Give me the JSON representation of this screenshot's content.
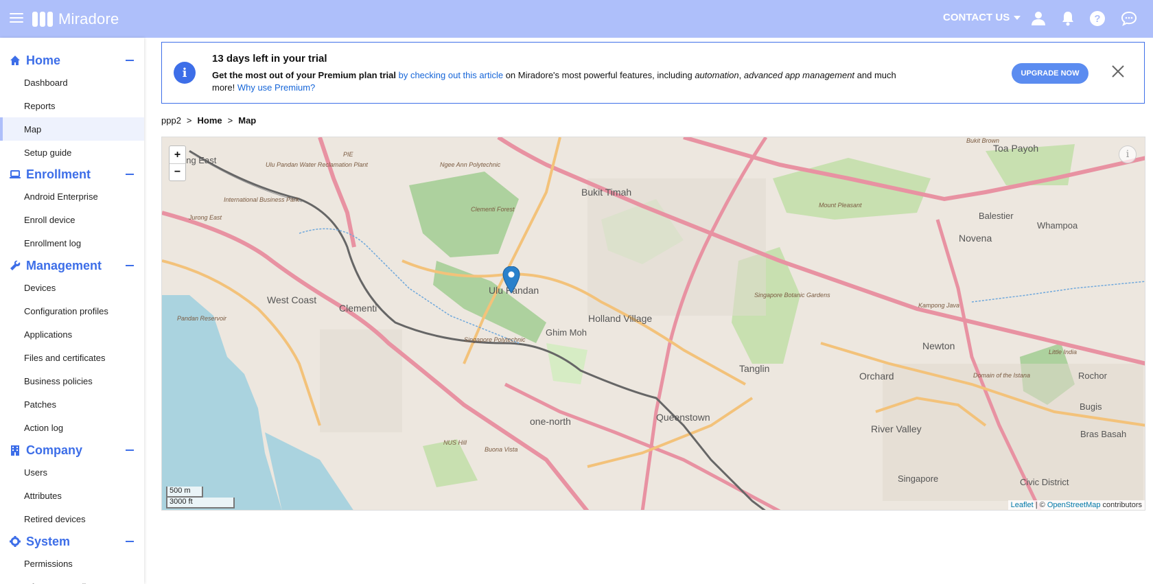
{
  "app": {
    "logo_text": "Miradore",
    "contact_label": "CONTACT US",
    "accent_color": "#3d6ee8",
    "topbar_color": "#aebffa"
  },
  "topbar_icons": [
    "user-icon",
    "bell-icon",
    "help-icon",
    "chat-icon"
  ],
  "sidebar": {
    "sections": [
      {
        "title": "Home",
        "icon": "home-icon",
        "items": [
          "Dashboard",
          "Reports",
          "Map",
          "Setup guide"
        ]
      },
      {
        "title": "Enrollment",
        "icon": "laptop-icon",
        "items": [
          "Android Enterprise",
          "Enroll device",
          "Enrollment log"
        ]
      },
      {
        "title": "Management",
        "icon": "wrench-icon",
        "items": [
          "Devices",
          "Configuration profiles",
          "Applications",
          "Files and certificates",
          "Business policies",
          "Patches",
          "Action log"
        ]
      },
      {
        "title": "Company",
        "icon": "building-icon",
        "items": [
          "Users",
          "Attributes",
          "Retired devices"
        ]
      },
      {
        "title": "System",
        "icon": "gear-icon",
        "items": [
          "Permissions",
          "Infrastructure diagram"
        ]
      }
    ],
    "active_item": "Map"
  },
  "banner": {
    "title": "13 days left in your trial",
    "text_bold": "Get the most out of your Premium plan trial",
    "link1": "by checking out this article",
    "text_mid": " on Miradore's most powerful features, including ",
    "em1": "automation",
    "sep": ", ",
    "em2": "advanced app management",
    "text_end": " and much more! ",
    "link2": "Why use Premium?",
    "upgrade_label": "UPGRADE NOW"
  },
  "breadcrumb": {
    "root": "ppp2",
    "sep": ">",
    "home": "Home",
    "current": "Map"
  },
  "map": {
    "zoom_in": "+",
    "zoom_out": "−",
    "info_glyph": "i",
    "scale_metric": "500 m",
    "scale_imperial": "3000 ft",
    "attrib_leaflet": "Leaflet",
    "attrib_sep": " | © ",
    "attrib_osm": "OpenStreetMap",
    "attrib_end": " contributors",
    "labels": [
      "Toa Payoh",
      "Bukit Timah",
      "Ulu Pandan",
      "Holland Village",
      "West Coast",
      "Clementi",
      "Ghim Moh",
      "Novena",
      "Balestier",
      "Whampoa",
      "Tanglin",
      "Orchard",
      "Newton",
      "River Valley",
      "Queenstown",
      "one-north",
      "Bras Basah",
      "Rochor",
      "Bugis",
      "Little India",
      "Clementi Forest",
      "Pandan Reservoir",
      "Singapore Botanic Gardens",
      "Singapore Polytechnic",
      "Ngee Ann Polytechnic",
      "Ulu Pandan Water Reclamation Plant",
      "International Business Park",
      "Jurong East",
      "Kampong Java",
      "Mount Pleasant",
      "Civic District",
      "Singapore",
      "NUS Hill",
      "Buona Vista",
      "Domain of the Istana",
      "Bukit Brown",
      "ong East",
      "PIE"
    ]
  }
}
